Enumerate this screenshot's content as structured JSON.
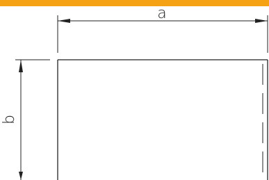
{
  "header": {
    "accent_color": "#F5A214"
  },
  "dimensions": {
    "width_label": "a",
    "height_label": "b"
  },
  "colors": {
    "line": "#222222"
  }
}
